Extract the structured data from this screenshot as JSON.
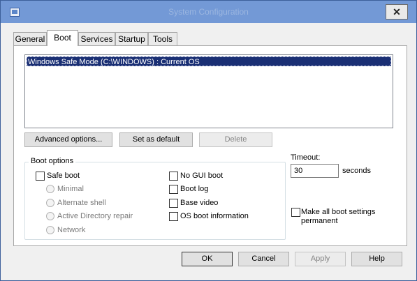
{
  "window": {
    "title": "System Configuration",
    "close_glyph": "✕"
  },
  "tabs": [
    {
      "label": "General"
    },
    {
      "label": "Boot"
    },
    {
      "label": "Services"
    },
    {
      "label": "Startup"
    },
    {
      "label": "Tools"
    }
  ],
  "boot": {
    "os_list": [
      "Windows Safe Mode (C:\\WINDOWS) : Current OS"
    ],
    "advanced_options_label": "Advanced options...",
    "set_default_label": "Set as default",
    "delete_label": "Delete",
    "boot_options_label": "Boot options",
    "safe_boot_label": "Safe boot",
    "minimal_label": "Minimal",
    "alternate_shell_label": "Alternate shell",
    "ad_repair_label": "Active Directory repair",
    "network_label": "Network",
    "no_gui_boot_label": "No GUI boot",
    "boot_log_label": "Boot log",
    "base_video_label": "Base video",
    "os_boot_info_label": "OS boot information",
    "timeout_label": "Timeout:",
    "timeout_value": "30",
    "seconds_label": "seconds",
    "make_permanent_line1": "Make all boot settings",
    "make_permanent_line2": "permanent"
  },
  "footer": {
    "ok_label": "OK",
    "cancel_label": "Cancel",
    "apply_label": "Apply",
    "help_label": "Help"
  }
}
